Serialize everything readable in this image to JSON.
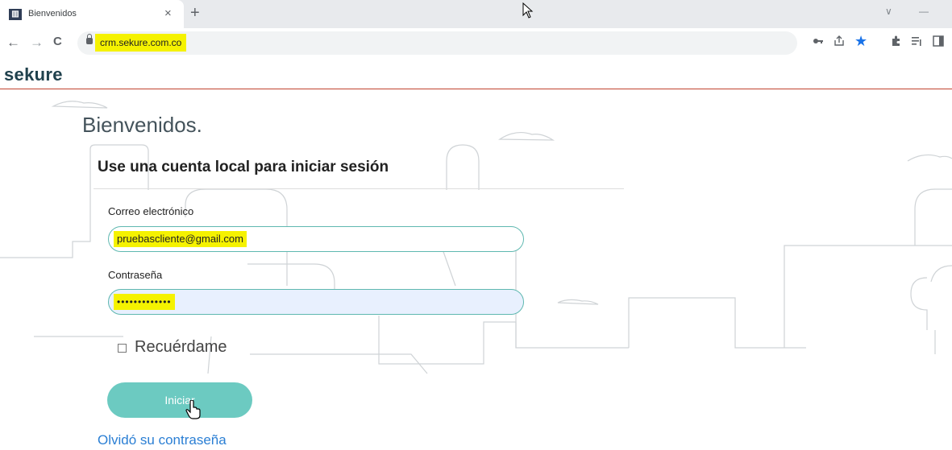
{
  "browser": {
    "tab_title": "Bienvenidos",
    "tab_favicon_glyph": "▥",
    "tab_close": "×",
    "new_tab": "+",
    "url": "crm.sekure.com.co",
    "nav": {
      "back": "←",
      "forward": "→",
      "reload": "C"
    },
    "window_controls": {
      "minimize_chevron": "∨",
      "minimize": "—"
    },
    "toolbar_icons": [
      "key-icon",
      "share-icon",
      "star-icon",
      "extensions-icon",
      "reading-list-icon",
      "side-panel-icon"
    ]
  },
  "header": {
    "logo": "sekure"
  },
  "login": {
    "welcome": "Bienvenidos.",
    "subtitle": "Use una cuenta local para iniciar sesión",
    "email_label": "Correo electrónico",
    "email_value": "pruebascliente@gmail.com",
    "password_label": "Contraseña",
    "password_value": "•••••••••••••",
    "remember_label": "Recuérdame",
    "submit_label": "Iniciar",
    "forgot_label": "Olvidó su contraseña"
  },
  "colors": {
    "brand_dark": "#20414d",
    "accent_teal": "#6ccac1",
    "highlight": "#f5f200",
    "link": "#2b7fd4",
    "header_rule": "#c0422f"
  }
}
